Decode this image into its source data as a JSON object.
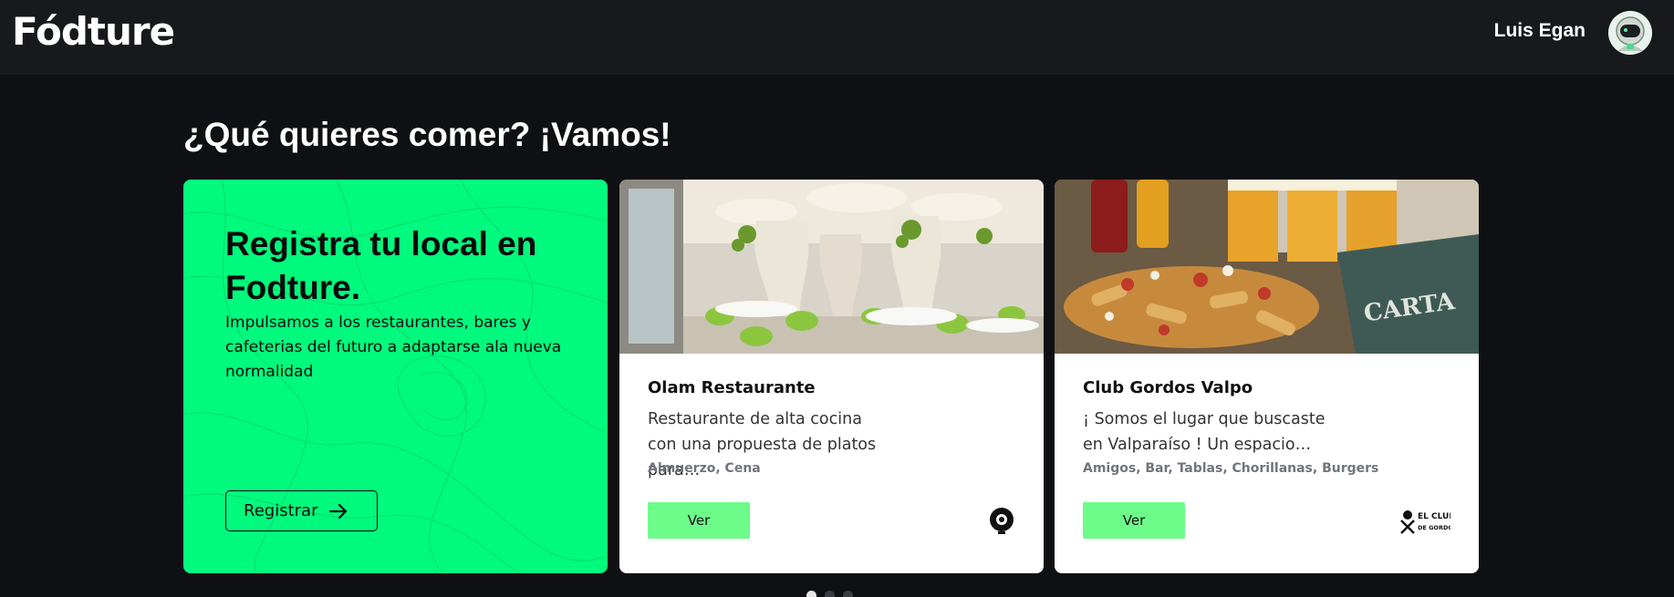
{
  "header": {
    "logo": "Fódture",
    "user_name": "Luis Egan"
  },
  "main": {
    "heading": "¿Qué quieres comer? ¡Vamos!"
  },
  "promo": {
    "title": "Registra tu local en Fodture.",
    "text": "Impulsamos a los restaurantes, bares y cafeterias del futuro a adaptarse ala nueva normalidad",
    "button_label": "Registrar",
    "accent_color": "#00fa7d"
  },
  "restaurants": [
    {
      "name": "Olam Restaurante",
      "description": "Restaurante de alta cocina con una propuesta de platos para…",
      "tags": "Almuerzo, Cena",
      "button_label": "Ver",
      "brand_icon": "olam-logo-icon"
    },
    {
      "name": "Club Gordos Valpo",
      "description": "¡ Somos el lugar que buscaste en Valparaíso ! Un espacio…",
      "tags": "Amigos, Bar, Tablas, Chorillanas, Burgers",
      "button_label": "Ver",
      "brand_icon": "el-club-de-gordos-logo-icon",
      "brand_text": "EL CLUB DE GORDOS"
    }
  ],
  "carousel": {
    "pages": 3,
    "active_page": 1
  },
  "colors": {
    "background": "#0f1013",
    "topbar": "#18191d",
    "ver_button": "#6dfc8a"
  }
}
